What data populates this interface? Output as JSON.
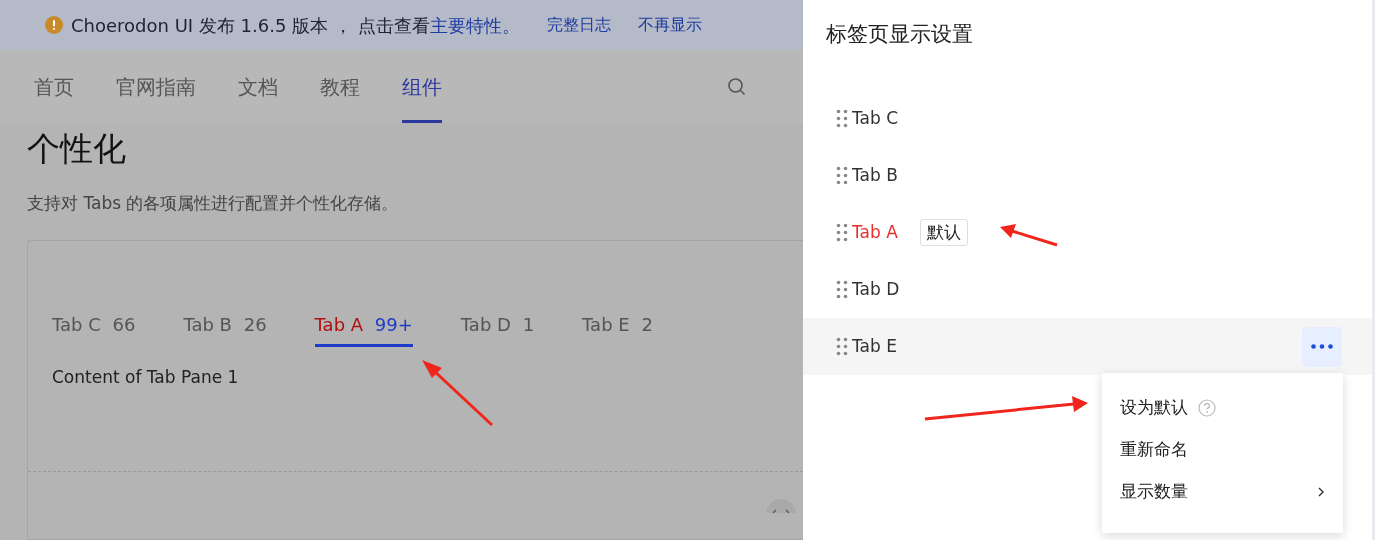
{
  "banner": {
    "text": "Choerodon UI 发布 1.6.5 版本 ， 点击查看",
    "link": "主要特性。",
    "actions": [
      "完整日志",
      "不再显示"
    ]
  },
  "nav": [
    {
      "label": "首页",
      "selected": false
    },
    {
      "label": "官网指南",
      "selected": false
    },
    {
      "label": "文档",
      "selected": false
    },
    {
      "label": "教程",
      "selected": false
    },
    {
      "label": "组件",
      "selected": true
    }
  ],
  "page": {
    "heading": "个性化",
    "description": "支持对 Tabs 的各项属性进行配置并个性化存储。",
    "demo_tabs": [
      {
        "label": "Tab C",
        "count": "66",
        "selected": false,
        "default": false
      },
      {
        "label": "Tab B",
        "count": "26",
        "selected": false,
        "default": false
      },
      {
        "label": "Tab A",
        "count": "99+",
        "selected": true,
        "default": true
      },
      {
        "label": "Tab D",
        "count": "1",
        "selected": false,
        "default": false
      },
      {
        "label": "Tab E",
        "count": "2",
        "selected": false,
        "default": false
      }
    ],
    "content": "Content of Tab Pane 1"
  },
  "drawer": {
    "title": "标签页显示设置",
    "items": [
      {
        "label": "Tab C",
        "default": false,
        "hovered": false
      },
      {
        "label": "Tab B",
        "default": false,
        "hovered": false
      },
      {
        "label": "Tab A",
        "default": true,
        "tag": "默认",
        "hovered": false
      },
      {
        "label": "Tab D",
        "default": false,
        "hovered": false
      },
      {
        "label": "Tab E",
        "default": false,
        "hovered": true
      }
    ],
    "menu": [
      {
        "label": "设为默认",
        "kind": "help"
      },
      {
        "label": "重新命名",
        "kind": "plain"
      },
      {
        "label": "显示数量",
        "kind": "submenu"
      }
    ]
  }
}
